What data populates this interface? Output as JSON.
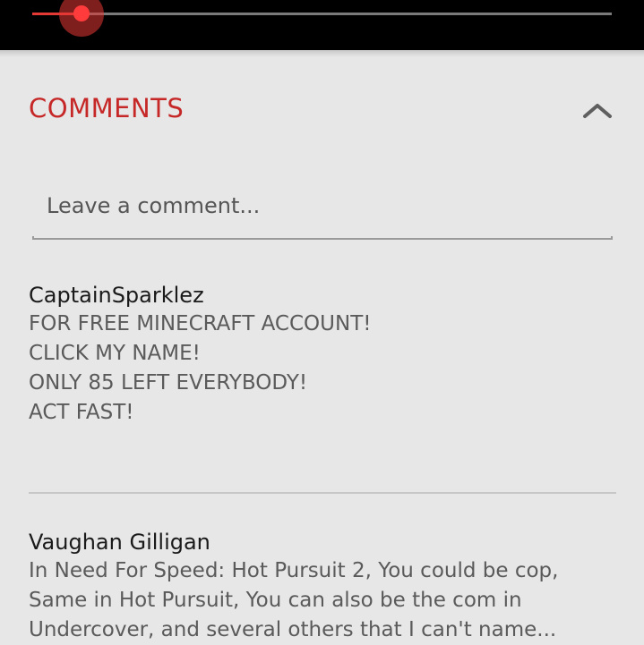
{
  "player": {
    "progress": 0.085
  },
  "comments_section": {
    "title": "COMMENTS",
    "collapse_icon": "chevron-up-icon",
    "input_placeholder": "Leave a comment...",
    "accent_color": "#c62828"
  },
  "comments": [
    {
      "author": "CaptainSparklez",
      "lines": [
        "FOR FREE MINECRAFT ACCOUNT!",
        "CLICK MY NAME!",
        "ONLY 85 LEFT EVERYBODY!",
        "ACT FAST!"
      ]
    },
    {
      "author": "Vaughan Gilligan",
      "lines": [
        "In Need For Speed: Hot Pursuit 2, You could be cop,",
        "Same in Hot Pursuit, You can also be the com in",
        "Undercover, and several others that I can't name..."
      ]
    }
  ]
}
